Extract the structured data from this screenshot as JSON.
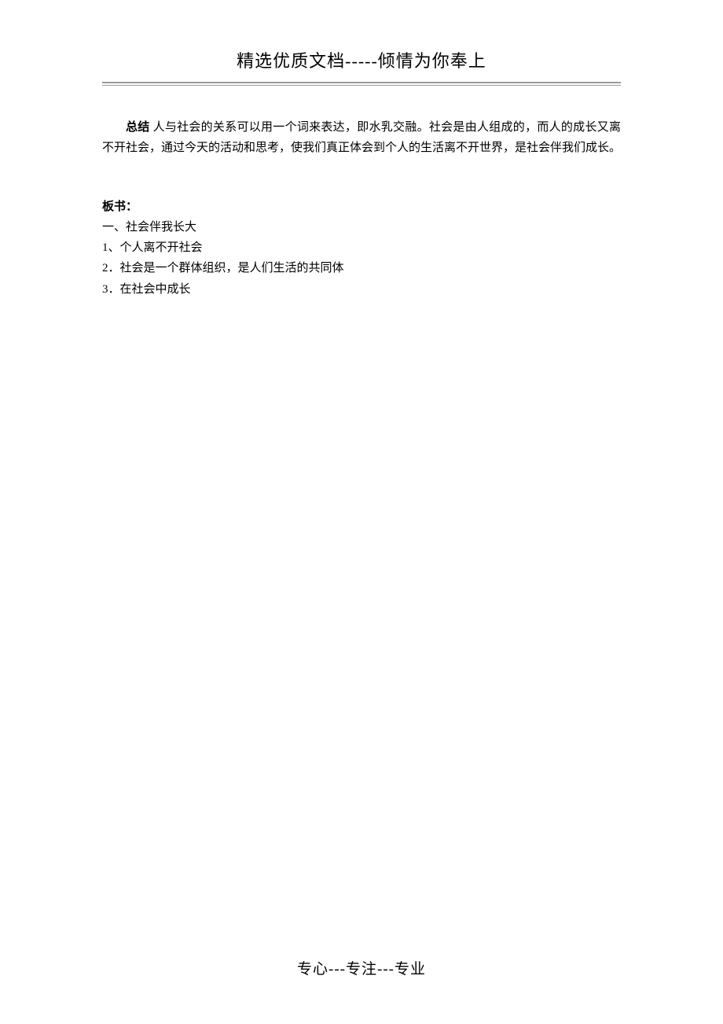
{
  "header": {
    "title": "精选优质文档-----倾情为你奉上"
  },
  "summary": {
    "label": "总结",
    "text": "人与社会的关系可以用一个词来表达，即水乳交融。社会是由人组成的，而人的成长又离不开社会，通过今天的活动和思考，使我们真正体会到个人的生活离不开世界，是社会伴我们成长。"
  },
  "banshu": {
    "title": "板书：",
    "items": [
      "一、社会伴我长大",
      "1、个人离不开社会",
      "2．社会是一个群体组织，是人们生活的共同体",
      "3．在社会中成长"
    ]
  },
  "footer": {
    "text": "专心---专注---专业"
  }
}
